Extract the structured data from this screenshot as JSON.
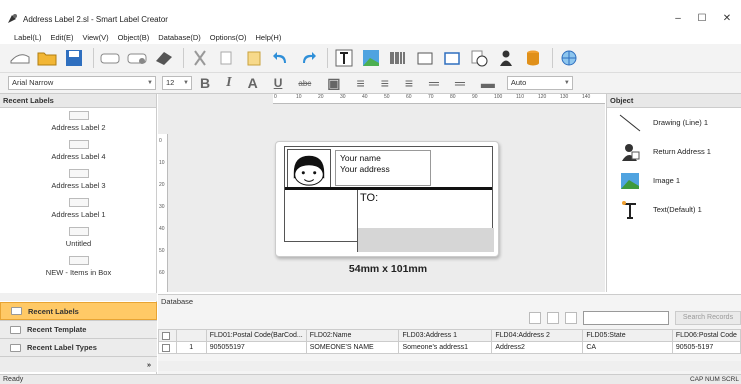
{
  "window": {
    "title": "Address Label 2.sl - Smart Label Creator",
    "minimize": "–",
    "maximize": "☐",
    "close": "✕"
  },
  "menu": [
    "Label(L)",
    "Edit(E)",
    "View(V)",
    "Object(B)",
    "Database(D)",
    "Options(O)",
    "Help(H)"
  ],
  "format": {
    "font": "Arial Narrow",
    "size": "12",
    "bold": "B",
    "italic": "I",
    "fontcolor": "A",
    "underline": "U",
    "strike": "abc",
    "auto": "Auto"
  },
  "left": {
    "header": "Recent Labels",
    "thumbs": [
      "Address Label 2",
      "Address Label 4",
      "Address Label 3",
      "Address Label 1",
      "Untitled",
      "NEW - Items in Box"
    ],
    "nav": [
      "Recent Labels",
      "Recent Template",
      "Recent Label Types"
    ]
  },
  "ruler": {
    "h": [
      "0",
      "10",
      "20",
      "30",
      "40",
      "50",
      "60",
      "70",
      "80",
      "90",
      "100",
      "110",
      "120",
      "130",
      "140"
    ],
    "v": [
      "0",
      "10",
      "20",
      "30",
      "40",
      "50",
      "60"
    ]
  },
  "label": {
    "name": "Your name",
    "address": "Your address",
    "to": "TO:",
    "dimension": "54mm x 101mm"
  },
  "objects": {
    "header": "Object",
    "items": [
      "Drawing (Line) 1",
      "Return Address 1",
      "Image 1",
      "Text(Default) 1"
    ]
  },
  "database": {
    "header": "Database",
    "search_button": "Search Records",
    "columns": [
      "FLD01:Postal Code(BarCod...",
      "FLD02:Name",
      "FLD03:Address 1",
      "FLD04:Address 2",
      "FLD05:State",
      "FLD06:Postal Code"
    ],
    "rows": [
      {
        "num": "1",
        "cells": [
          "905055197",
          "SOMEONE'S NAME",
          "Someone's address1",
          "Address2",
          "CA",
          "90505-5197"
        ]
      }
    ]
  },
  "status": {
    "left": "Ready",
    "right": "CAP NUM SCRL"
  }
}
